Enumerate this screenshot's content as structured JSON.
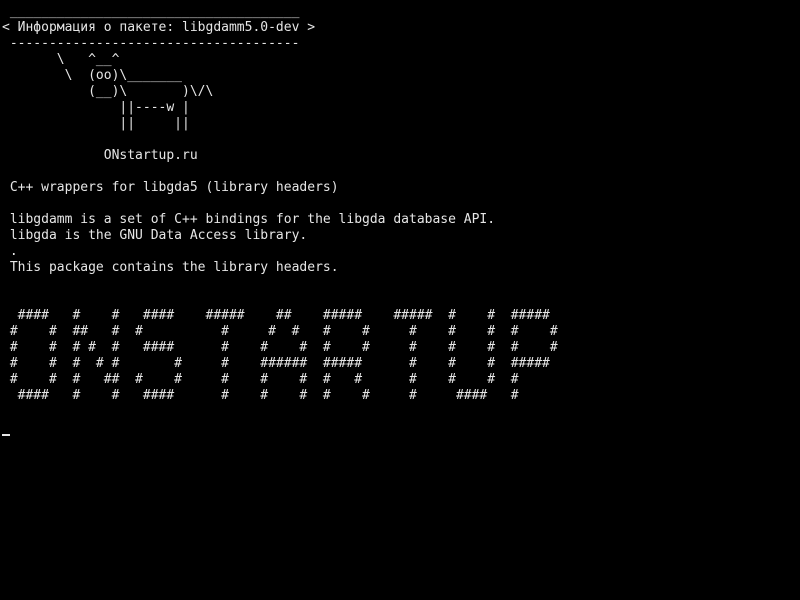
{
  "console": {
    "lines": [
      " _____________________________________",
      "< Информация о пакете: libgdamm5.0-dev >",
      " -------------------------------------",
      "       \\   ^__^",
      "        \\  (oo)\\_______",
      "           (__)\\       )\\/\\",
      "               ||----w |",
      "               ||     ||",
      "",
      "             ONstartup.ru",
      "",
      " C++ wrappers for libgda5 (library headers)",
      "",
      " libgdamm is a set of C++ bindings for the libgda database API.",
      " libgda is the GNU Data Access library.",
      " .",
      " This package contains the library headers.",
      "",
      "",
      "  ####   #    #   ####    #####    ##    #####    #####  #    #  #####",
      " #    #  ##   #  #          #     #  #   #    #     #    #    #  #    #",
      " #    #  # #  #   ####      #    #    #  #    #     #    #    #  #    #",
      " #    #  #  # #       #     #    ######  #####      #    #    #  #####",
      " #    #  #   ##  #    #     #    #    #  #   #      #    #    #  #",
      "  ####   #    #   ####      #    #    #  #    #     #     ####   #",
      ""
    ]
  }
}
